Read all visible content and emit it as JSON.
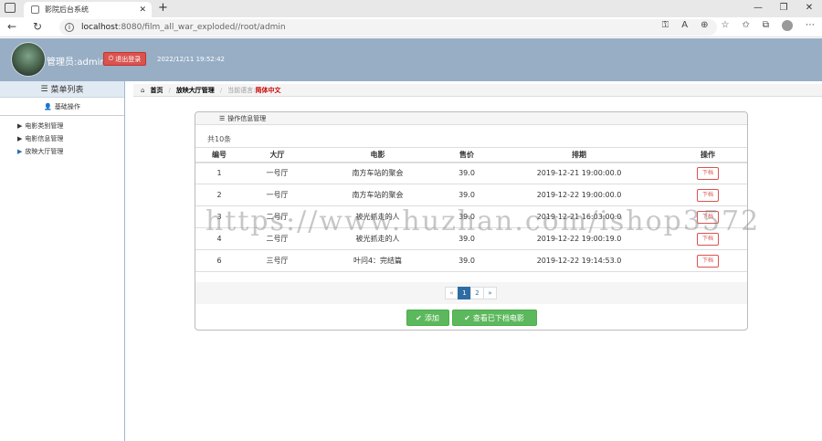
{
  "browser": {
    "tab_title": "影院后台系统",
    "url_host": "localhost",
    "url_path": ":8080/film_all_war_exploded//root/admin"
  },
  "header": {
    "admin_label": "管理员:admin",
    "logout_label": "退出登录",
    "datetime": "2022/12/11 19:52:42"
  },
  "sidebar": {
    "title": "菜单列表",
    "section": "基础操作",
    "items": [
      {
        "label": "电影类别管理"
      },
      {
        "label": "电影信息管理"
      },
      {
        "label": "放映大厅管理"
      }
    ]
  },
  "breadcrumb": {
    "home": "首页",
    "current": "放映大厅管理",
    "lang_label": "当前语言:",
    "lang_value": "简体中文"
  },
  "panel": {
    "title": "操作信息管理",
    "count": "共10条",
    "columns": [
      "编号",
      "大厅",
      "电影",
      "售价",
      "排期",
      "操作"
    ],
    "rows": [
      [
        "1",
        "一号厅",
        "南方车站的聚会",
        "39.0",
        "2019-12-21 19:00:00.0",
        "下档"
      ],
      [
        "2",
        "一号厅",
        "南方车站的聚会",
        "39.0",
        "2019-12-22 19:00:00.0",
        "下档"
      ],
      [
        "3",
        "二号厅",
        "被光抓走的人",
        "39.0",
        "2019-12-21 16:03:00.0",
        "下档"
      ],
      [
        "4",
        "二号厅",
        "被光抓走的人",
        "39.0",
        "2019-12-22 19:00:19.0",
        "下档"
      ],
      [
        "6",
        "三号厅",
        "叶问4：完结篇",
        "39.0",
        "2019-12-22 19:14:53.0",
        "下档"
      ]
    ],
    "pager": {
      "prev": "«",
      "pages": [
        "1",
        "2"
      ],
      "next": "»"
    },
    "add_label": "添加",
    "view_label": "查看已下档电影"
  },
  "watermark": "https://www.huzhan.com/ishop3572"
}
